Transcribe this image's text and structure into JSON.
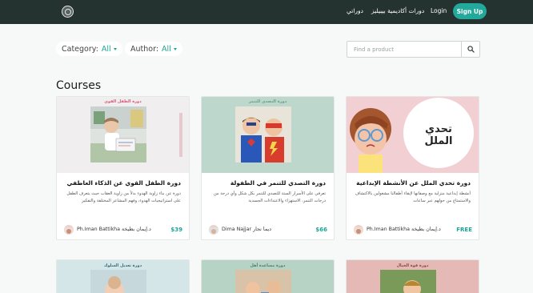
{
  "nav": {
    "courses_link": "دوراتي",
    "academy_link": "دورات أكاديمية بيبيليز",
    "login": "Login",
    "signup": "Sign Up"
  },
  "filters": {
    "category_label": "Category:",
    "category_value": "All",
    "author_label": "Author:",
    "author_value": "All"
  },
  "search": {
    "placeholder": "Find a product",
    "icon": "search-icon"
  },
  "section_title": "Courses",
  "courses": [
    {
      "thumb_label": "دورة الطفل القوي",
      "thumb_bg": "#f1eef0",
      "title": "دورة الطفل القوي عن الذكاء العاطفي",
      "desc": "دورة عن بناء زاوية الهدوء بدلاً من زاوية العقاب حيث يتعرف الطفل على استراتيجيات الهدوء، وفهم المشاعر المختلفة والتفكير والسلوكيات",
      "author": "Ph.Iman Battikha د.إيمان بطيخة",
      "price": "$39"
    },
    {
      "thumb_label": "دورة التصدي للتنمر",
      "thumb_bg": "#bdd7cc",
      "title": "دورة التصدي للتنمر في الطفولة",
      "desc": "تعرفي على الأسرار الستة للتصدي للتنمر بكل شكل وأي درجة من درجات التنمر، الاستهزاء والاعتداءات الجسدية",
      "author": "Dima Najjar ديما نجار",
      "price": "$66"
    },
    {
      "thumb_label": "تحدي الملل",
      "thumb_bg": "#f2cfd3",
      "title": "دورة تحدي الملل عن الأنشطة الإبداعية",
      "desc": "أنشطة إبداعية منزلية مع وصفاتها لإبقاء أطفالنا مشغولين بالاكتشاف والاستمتاع من حولهم عبر ساعات",
      "author": "Ph.Iman Battikha د.إيمان بطيخة",
      "price": "FREE"
    },
    {
      "thumb_label": "دورة تعديل السلوك",
      "thumb_bg": "#d4e6e8"
    },
    {
      "thumb_label": "دورة مساعدة أهل",
      "thumb_bg": "#b6d3c6"
    },
    {
      "thumb_label": "دورة قوة الخيال",
      "thumb_bg": "#e4b9b6"
    }
  ]
}
